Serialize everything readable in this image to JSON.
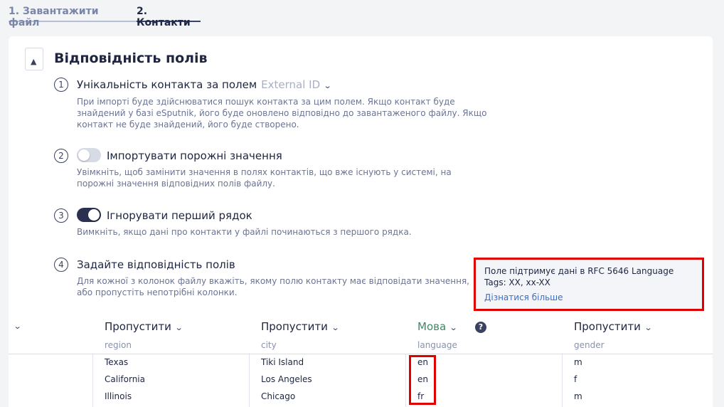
{
  "steps": [
    {
      "label": "1. Завантажити файл"
    },
    {
      "label": "2. Контакти"
    }
  ],
  "card": {
    "title": "Відповідність полів"
  },
  "sections": {
    "s1": {
      "num": "1",
      "title": "Унікальність контакта за полем",
      "select_value": "External ID",
      "desc": "При імпорті буде здійснюватися пошук контакта за цим полем. Якщо контакт буде знайдений у базі eSputnik, його буде оновлено відповідно до завантаженого файлу. Якщо контакт не буде знайдений, його буде створено."
    },
    "s2": {
      "num": "2",
      "title": "Імпортувати порожні значення",
      "toggle_on": false,
      "desc": "Увімкніть, щоб замінити значення в полях контактів, що вже існують у системі, на порожні значення відповідних полів файлу."
    },
    "s3": {
      "num": "3",
      "title": "Ігнорувати перший рядок",
      "toggle_on": true,
      "desc": "Вимкніть, якщо дані про контакти у файлі починаються з першого рядка."
    },
    "s4": {
      "num": "4",
      "title": "Задайте відповідність полів",
      "desc": "Для кожної з колонок файлу вкажіть, якому полю контакту має відповідати значення, або пропустіть непотрібні колонки."
    }
  },
  "tooltip": {
    "line1": "Поле підтримує дані в RFC 5646 Language",
    "line2": "Tags: XX, xx-XX",
    "link": "Дізнатися більше"
  },
  "columns": [
    {
      "field": "Пропустити",
      "source": "region",
      "values": [
        "Texas",
        "California",
        "Illinois"
      ]
    },
    {
      "field": "Пропустити",
      "source": "city",
      "values": [
        "Tiki Island",
        "Los Angeles",
        "Chicago"
      ]
    },
    {
      "field": "Мова",
      "source": "language",
      "values": [
        "en",
        "en",
        "fr"
      ]
    },
    {
      "field": "Пропустити",
      "source": "gender",
      "values": [
        "m",
        "f",
        "m"
      ]
    }
  ],
  "colors": {
    "accent": "#2a3150",
    "active_field": "#3b8a64",
    "link": "#3a6fc4",
    "highlight": "#e00000"
  }
}
